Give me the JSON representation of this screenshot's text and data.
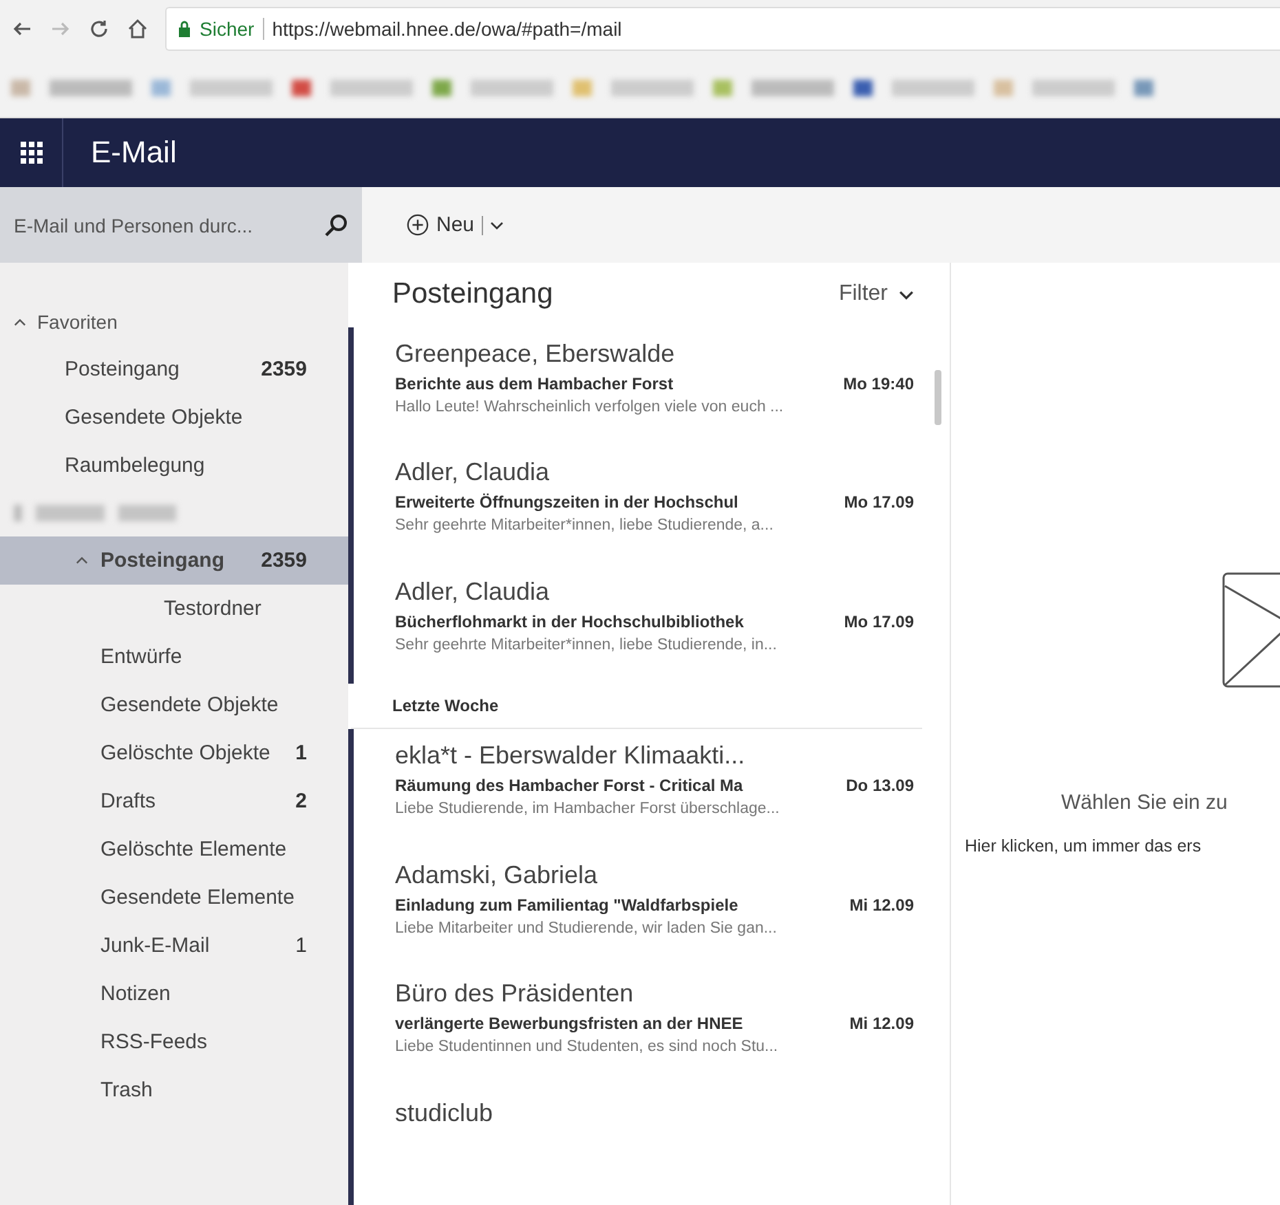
{
  "browser": {
    "secure_label": "Sicher",
    "url": "https://webmail.hnee.de/owa/#path=/mail"
  },
  "app": {
    "title": "E-Mail"
  },
  "search": {
    "placeholder": "E-Mail und Personen durc..."
  },
  "toolbar": {
    "new_label": "Neu"
  },
  "sidebar": {
    "sections": [
      {
        "kind": "group",
        "label": "Favoriten",
        "expanded": true,
        "children": [
          {
            "label": "Posteingang",
            "count": "2359",
            "unread": true,
            "selected": false
          },
          {
            "label": "Gesendete Objekte",
            "selected": false
          },
          {
            "label": "Raumbelegung",
            "selected": false
          }
        ]
      },
      {
        "kind": "blurred",
        "children": [
          {
            "label": "Posteingang",
            "count": "2359",
            "unread": true,
            "selected": true,
            "expanded": true,
            "children": [
              {
                "label": "Testordner",
                "selected": false
              }
            ]
          },
          {
            "label": "Entwürfe",
            "selected": false
          },
          {
            "label": "Gesendete Objekte",
            "selected": false
          },
          {
            "label": "Gelöschte Objekte",
            "count": "1",
            "unread": true,
            "selected": false
          },
          {
            "label": "Drafts",
            "count": "2",
            "unread": true,
            "selected": false
          },
          {
            "label": "Gelöschte Elemente",
            "selected": false
          },
          {
            "label": "Gesendete Elemente",
            "selected": false
          },
          {
            "label": "Junk-E-Mail",
            "count": "1",
            "unread": false,
            "selected": false
          },
          {
            "label": "Notizen",
            "selected": false
          },
          {
            "label": "RSS-Feeds",
            "selected": false
          },
          {
            "label": "Trash",
            "selected": false
          }
        ]
      }
    ]
  },
  "message_list": {
    "title": "Posteingang",
    "filter": "Filter",
    "items": [
      {
        "kind": "message",
        "unread": true,
        "sender": "Greenpeace, Eberswalde",
        "subject": "Berichte aus dem Hambacher Forst",
        "date": "Mo 19:40",
        "preview": "Hallo Leute! Wahrscheinlich verfolgen viele von euch ..."
      },
      {
        "kind": "message",
        "unread": true,
        "sender": "Adler, Claudia",
        "subject": "Erweiterte Öffnungszeiten in der Hochschul",
        "date": "Mo 17.09",
        "preview": "Sehr geehrte Mitarbeiter*innen, liebe Studierende,  a..."
      },
      {
        "kind": "message",
        "unread": true,
        "sender": "Adler, Claudia",
        "subject": "Bücherflohmarkt in der Hochschulbibliothek",
        "date": "Mo 17.09",
        "preview": "Sehr geehrte Mitarbeiter*innen, liebe Studierende,  in..."
      },
      {
        "kind": "header",
        "label": "Letzte Woche"
      },
      {
        "kind": "message",
        "unread": true,
        "sender": "ekla*t - Eberswalder Klimaakti...",
        "subject": "Räumung des Hambacher Forst - Critical Ma",
        "date": "Do 13.09",
        "preview": "Liebe Studierende,  im Hambacher Forst überschlage..."
      },
      {
        "kind": "message",
        "unread": true,
        "sender": "Adamski, Gabriela",
        "subject": "Einladung zum Familientag \"Waldfarbspiele",
        "date": "Mi 12.09",
        "preview": "Liebe Mitarbeiter und Studierende,  wir laden Sie gan..."
      },
      {
        "kind": "message",
        "unread": true,
        "sender": "Büro des Präsidenten",
        "subject": "verlängerte Bewerbungsfristen an der HNEE",
        "date": "Mi 12.09",
        "preview": "Liebe Studentinnen und Studenten,  es sind noch Stu..."
      },
      {
        "kind": "message",
        "unread": true,
        "sender": "studiclub"
      }
    ]
  },
  "reading_pane": {
    "title": "Wählen Sie ein zu",
    "link": "Hier klicken, um immer das ers"
  }
}
